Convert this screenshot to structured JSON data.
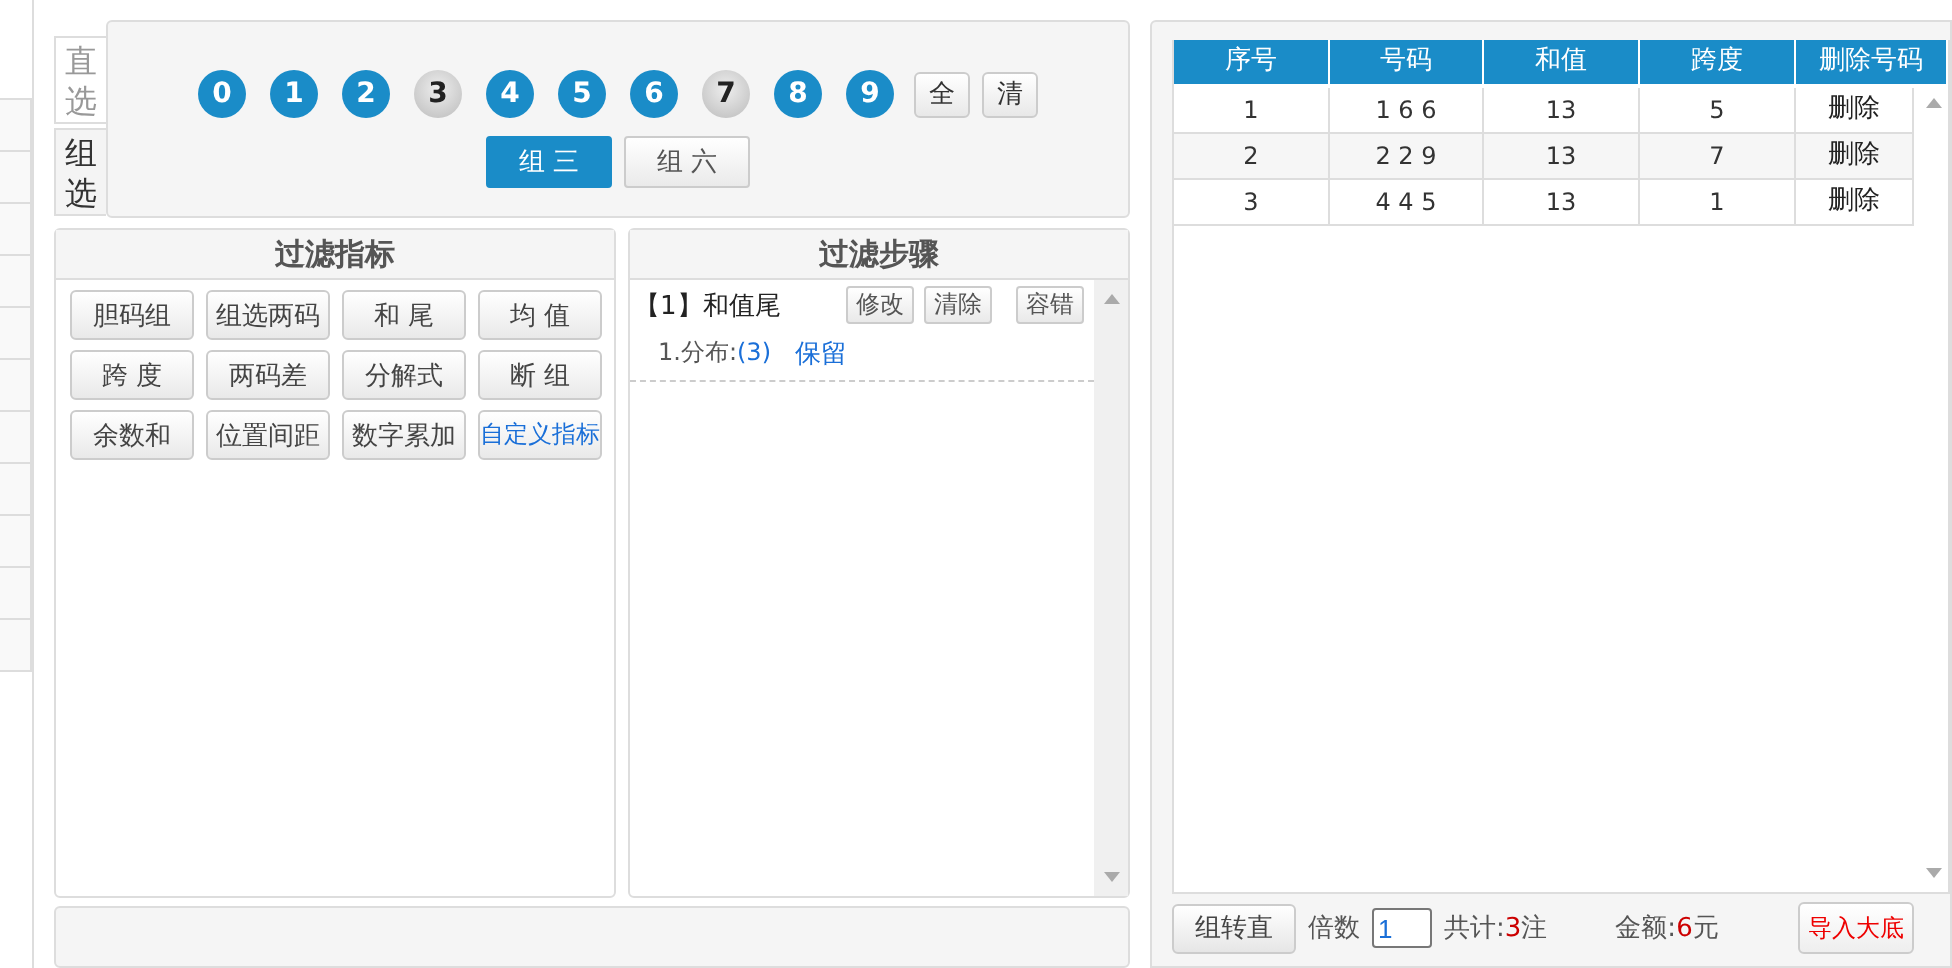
{
  "mode_tabs": [
    {
      "label": "直选",
      "selected": false
    },
    {
      "label": "组选",
      "selected": true
    }
  ],
  "digits": [
    {
      "label": "0",
      "selected": true
    },
    {
      "label": "1",
      "selected": true
    },
    {
      "label": "2",
      "selected": true
    },
    {
      "label": "3",
      "selected": false
    },
    {
      "label": "4",
      "selected": true
    },
    {
      "label": "5",
      "selected": true
    },
    {
      "label": "6",
      "selected": true
    },
    {
      "label": "7",
      "selected": false
    },
    {
      "label": "8",
      "selected": true
    },
    {
      "label": "9",
      "selected": true
    }
  ],
  "digit_actions": [
    "全",
    "清"
  ],
  "group_types": [
    {
      "label": "组 三",
      "selected": true
    },
    {
      "label": "组 六",
      "selected": false
    }
  ],
  "filter_indicators": {
    "title": "过滤指标",
    "buttons": [
      {
        "label": "胆码组",
        "kind": "normal"
      },
      {
        "label": "组选两码",
        "kind": "normal"
      },
      {
        "label": "和 尾",
        "kind": "normal"
      },
      {
        "label": "均 值",
        "kind": "normal"
      },
      {
        "label": "跨 度",
        "kind": "normal"
      },
      {
        "label": "两码差",
        "kind": "normal"
      },
      {
        "label": "分解式",
        "kind": "normal"
      },
      {
        "label": "断 组",
        "kind": "normal"
      },
      {
        "label": "余数和",
        "kind": "normal"
      },
      {
        "label": "位置间距",
        "kind": "normal"
      },
      {
        "label": "数字累加",
        "kind": "normal"
      },
      {
        "label": "自定义指标",
        "kind": "custom"
      }
    ]
  },
  "filter_steps": {
    "title": "过滤步骤",
    "steps": [
      {
        "label": "【1】和值尾",
        "actions": [
          "修改",
          "清除",
          "容错"
        ],
        "details": [
          {
            "text": "1.分布:",
            "value": "(3)",
            "action": "保留"
          }
        ]
      }
    ]
  },
  "table": {
    "columns": [
      "序号",
      "号码",
      "和值",
      "跨度",
      "删除号码"
    ],
    "rows": [
      [
        "1",
        "1 6 6",
        "13",
        "5",
        "删除"
      ],
      [
        "2",
        "2 2 9",
        "13",
        "7",
        "删除"
      ],
      [
        "3",
        "4 4 5",
        "13",
        "1",
        "删除"
      ]
    ]
  },
  "footer": {
    "convert_button": "组转直",
    "multiplier_label": "倍数",
    "multiplier_value": "1",
    "total_label": "共计:",
    "total_count": "3",
    "total_unit": "注",
    "amount_label": "金额:",
    "amount_value": "6",
    "amount_unit": "元",
    "import_button": "导入大底"
  }
}
